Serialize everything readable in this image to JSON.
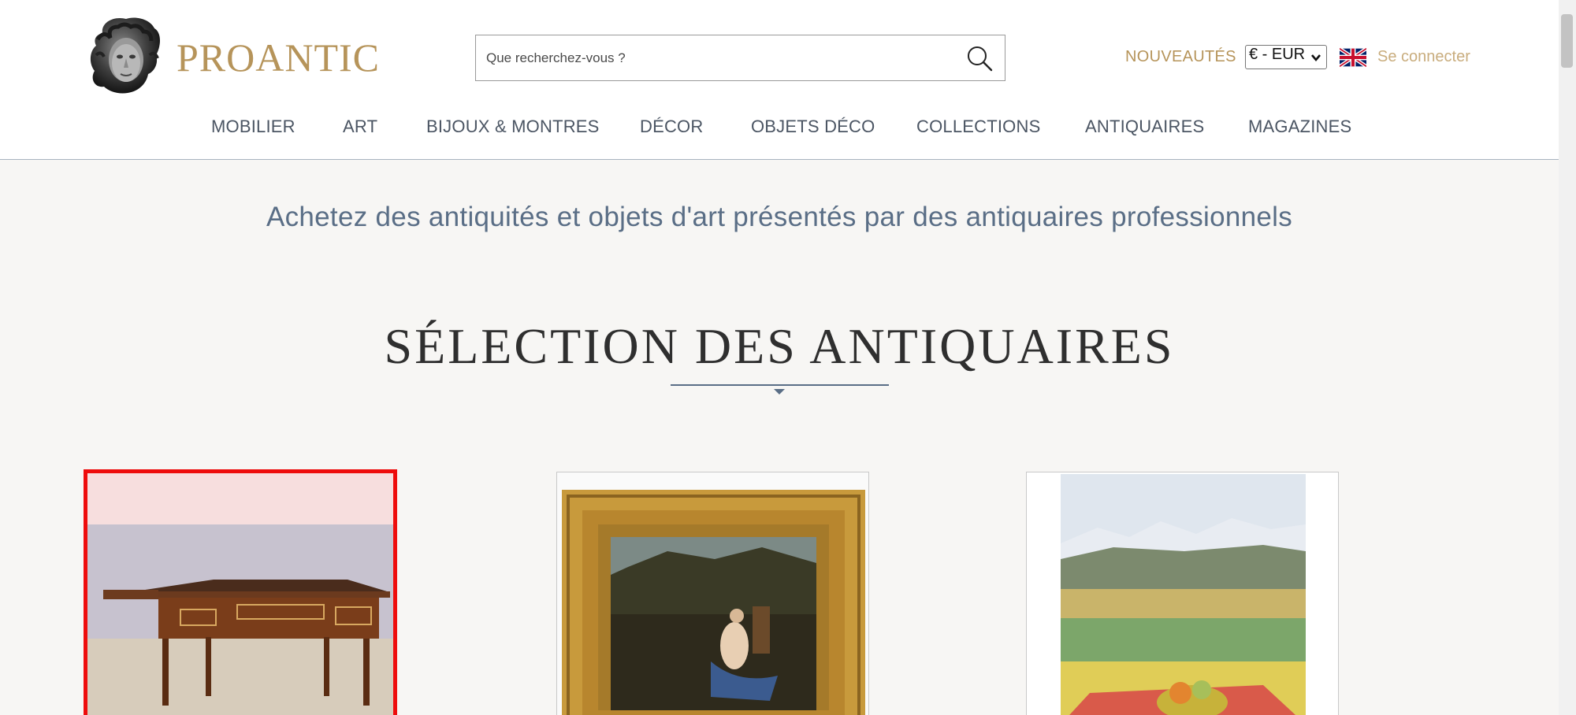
{
  "header": {
    "brand": "PROANTIC",
    "search_placeholder": "Que recherchez-vous ?",
    "news_label": "NOUVEAUTÉS",
    "currency": "€ - EUR",
    "login_label": "Se connecter",
    "flag_icon": "uk-flag-icon"
  },
  "nav": {
    "items": [
      {
        "label": "MOBILIER"
      },
      {
        "label": "ART"
      },
      {
        "label": "BIJOUX & MONTRES"
      },
      {
        "label": "DÉCOR"
      },
      {
        "label": "OBJETS DÉCO"
      },
      {
        "label": "COLLECTIONS"
      },
      {
        "label": "ANTIQUAIRES"
      },
      {
        "label": "MAGAZINES"
      }
    ]
  },
  "main": {
    "tagline": "Achetez des antiquités et objets d'art présentés par des antiquaires professionnels",
    "section_title": "SÉLECTION DES ANTIQUAIRES",
    "cards": [
      {
        "subject": "mahogany desk",
        "selected": true
      },
      {
        "subject": "framed painting"
      },
      {
        "subject": "landscape painting"
      }
    ]
  },
  "colors": {
    "brand_gold": "#b6945a",
    "nav_text": "#4b5563",
    "accent_blue": "#5a6e86",
    "selection_red": "#ee0c0c"
  }
}
